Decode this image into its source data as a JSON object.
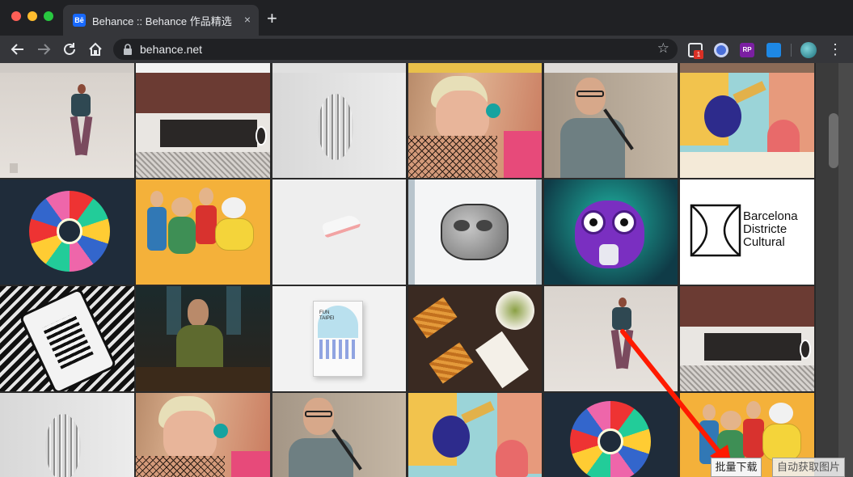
{
  "browser": {
    "tab_title": "Behance :: Behance 作品精选",
    "tab_favicon": "Bē",
    "new_tab": "+",
    "tab_close": "×",
    "url": "behance.net",
    "extension_badge": "1",
    "extension_rp": "RP",
    "icons": [
      "back-arrow-icon",
      "forward-arrow-icon",
      "reload-icon",
      "home-icon",
      "lock-icon",
      "star-icon",
      "menu-icon"
    ]
  },
  "gallery": {
    "tiles": [
      {
        "label": "Dancer in purple pants"
      },
      {
        "label": "Minimal bar interior"
      },
      {
        "label": "Fluted round mirror"
      },
      {
        "label": "Red-haired model in fishnet"
      },
      {
        "label": "Man speaking at microphone"
      },
      {
        "label": "Creature illustration"
      },
      {
        "label": "Kaleidoscope pattern"
      },
      {
        "label": "Clay characters group"
      },
      {
        "label": "White sneaker"
      },
      {
        "label": "Ink sketch figure"
      },
      {
        "label": "Purple owl character"
      },
      {
        "label": "Barcelona Districte Cultural logo"
      },
      {
        "label": "Patterned playing card"
      },
      {
        "label": "Woman in church"
      },
      {
        "label": "Fun Taipei book"
      },
      {
        "label": "Waffle food flatlay"
      },
      {
        "label": "Dancer in purple pants"
      },
      {
        "label": "Minimal bar interior"
      },
      {
        "label": "Fluted round mirror"
      },
      {
        "label": "Red-haired model in fishnet"
      },
      {
        "label": "Man speaking at microphone"
      },
      {
        "label": "Creature illustration"
      },
      {
        "label": "Kaleidoscope pattern"
      },
      {
        "label": "Clay characters group"
      }
    ],
    "logo_lines": [
      "Barcelona",
      "Districte",
      "Cultural"
    ],
    "book_title": "FUN\nTAIPEI"
  },
  "overlay": {
    "batch_download": "批量下载",
    "auto_fetch": "自动获取图片",
    "arrow_color": "#ff1a00"
  }
}
